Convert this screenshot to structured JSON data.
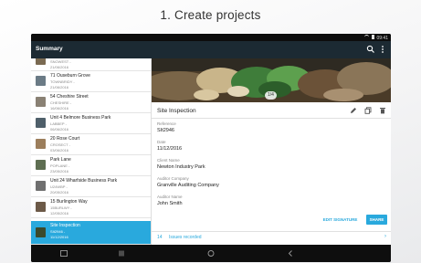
{
  "caption": "1.  Create projects",
  "status_bar": {
    "time": "09:41"
  },
  "app_bar": {
    "title": "Summary"
  },
  "list": {
    "items": [
      {
        "title": "",
        "subtitle": "SNOWEST -",
        "date": "21/06/2016"
      },
      {
        "title": "71 Ouseburn Grove",
        "subtitle": "TOWNBRIDY -",
        "date": "21/06/2016"
      },
      {
        "title": "54 Cheshire Street",
        "subtitle": "CHESHIRE -",
        "date": "16/06/2016"
      },
      {
        "title": "Unit 4 Belmore Business Park",
        "subtitle": "LABBEP -",
        "date": "06/06/2016"
      },
      {
        "title": "20 Rose Court",
        "subtitle": "CROSECT -",
        "date": "03/06/2016"
      },
      {
        "title": "Park Lane",
        "subtitle": "POPLANE -",
        "date": "23/05/2016"
      },
      {
        "title": "Unit 24 Wharfside Business Park",
        "subtitle": "U24WBP -",
        "date": "20/05/2016"
      },
      {
        "title": "15 Burlington Way",
        "subtitle": "15BURLWY -",
        "date": "12/05/2016"
      },
      {
        "title": "Site Inspection",
        "subtitle": "SIt2946 -",
        "date": "11/12/2016",
        "selected": true
      }
    ],
    "fab_label": "+"
  },
  "detail": {
    "title": "Site Inspection",
    "image_badge": "1/4",
    "fields": [
      {
        "label": "Reference",
        "value": "SIt2946"
      },
      {
        "label": "Date",
        "value": "11/12/2016"
      },
      {
        "label": "Client Name",
        "value": "Newton Industry Park"
      },
      {
        "label": "Auditor Company",
        "value": "Granville Auditing Company"
      },
      {
        "label": "Auditor Name",
        "value": "John Smith"
      }
    ],
    "edit_signature_label": "EDIT SIGNATURE",
    "share_label": "SHARE",
    "issues_count": "14",
    "issues_label": "Issues recorded"
  },
  "colors": {
    "accent": "#29a9dd",
    "app_bar": "#1c2a33",
    "selected_row": "#29a9dd"
  },
  "icons": {
    "app_bar": [
      "search-icon",
      "more-vert-icon"
    ],
    "detail_tools": [
      "edit-icon",
      "copy-icon",
      "delete-icon"
    ],
    "nav_bar": [
      "recent-apps-icon",
      "menu-icon",
      "home-icon",
      "back-icon"
    ]
  }
}
